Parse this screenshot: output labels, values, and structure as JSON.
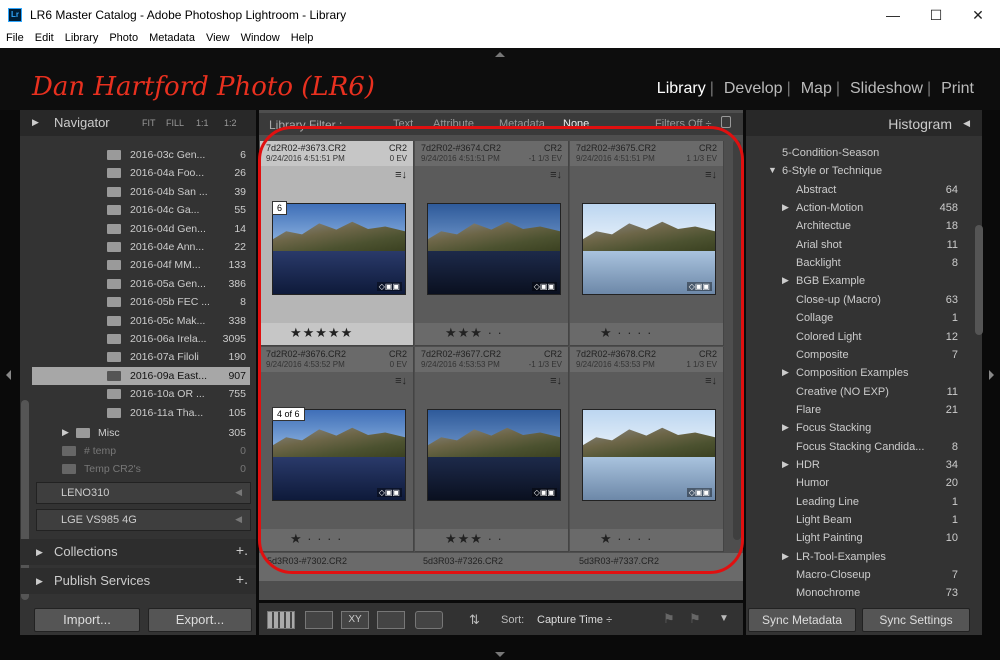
{
  "window": {
    "title": "LR6 Master Catalog - Adobe Photoshop Lightroom - Library",
    "app_icon": "Lr",
    "controls": {
      "minimize": "—",
      "maximize": "☐",
      "close": "✕"
    }
  },
  "menu": [
    "File",
    "Edit",
    "Library",
    "Photo",
    "Metadata",
    "View",
    "Window",
    "Help"
  ],
  "identity_plate": "Dan Hartford Photo (LR6)",
  "modules": [
    {
      "label": "Library",
      "active": true
    },
    {
      "label": "Develop",
      "active": false
    },
    {
      "label": "Map",
      "active": false
    },
    {
      "label": "Slideshow",
      "active": false
    },
    {
      "label": "Print",
      "active": false
    }
  ],
  "navigator": {
    "title": "Navigator",
    "zoom": [
      "FIT",
      "FILL",
      "1:1",
      "1:2"
    ]
  },
  "folders": [
    {
      "name": "2016-03c Gen...",
      "count": "6",
      "selected": false
    },
    {
      "name": "2016-04a Foo...",
      "count": "26",
      "selected": false
    },
    {
      "name": "2016-04b San ...",
      "count": "39",
      "selected": false
    },
    {
      "name": "2016-04c Ga...",
      "count": "55",
      "selected": false
    },
    {
      "name": "2016-04d Gen...",
      "count": "14",
      "selected": false
    },
    {
      "name": "2016-04e Ann...",
      "count": "22",
      "selected": false
    },
    {
      "name": "2016-04f MM...",
      "count": "133",
      "selected": false
    },
    {
      "name": "2016-05a Gen...",
      "count": "386",
      "selected": false
    },
    {
      "name": "2016-05b FEC ...",
      "count": "8",
      "selected": false
    },
    {
      "name": "2016-05c Mak...",
      "count": "338",
      "selected": false
    },
    {
      "name": "2016-06a Irela...",
      "count": "3095",
      "selected": false
    },
    {
      "name": "2016-07a Filoli",
      "count": "190",
      "selected": false
    },
    {
      "name": "2016-09a East...",
      "count": "907",
      "selected": true
    },
    {
      "name": "2016-10a OR ...",
      "count": "755",
      "selected": false
    },
    {
      "name": "2016-11a Tha...",
      "count": "105",
      "selected": false
    }
  ],
  "misc_folders": [
    {
      "name": "Misc",
      "count": "305"
    },
    {
      "name": "# temp",
      "count": "0"
    },
    {
      "name": "Temp CR2's",
      "count": "0"
    }
  ],
  "devices": [
    "LENO310",
    "LGE VS985 4G"
  ],
  "collections_label": "Collections",
  "publish_label": "Publish Services",
  "import_label": "Import...",
  "export_label": "Export...",
  "filter_bar": {
    "label": "Library Filter :",
    "options": [
      "Text",
      "Attribute",
      "Metadata",
      "None"
    ],
    "filters_off": "Filters Off ÷"
  },
  "grid": [
    {
      "file": "7d2R02-#3673.CR2",
      "ext": "CR2",
      "date": "9/24/2016 4:51:51 PM",
      "ev": "0 EV",
      "badge": "6",
      "stars": "★★★★★",
      "selected": true
    },
    {
      "file": "7d2R02-#3674.CR2",
      "ext": "CR2",
      "date": "9/24/2016 4:51:51 PM",
      "ev": "-1 1/3 EV",
      "badge": "",
      "stars": "★★★ · ·",
      "selected": false
    },
    {
      "file": "7d2R02-#3675.CR2",
      "ext": "CR2",
      "date": "9/24/2016 4:51:51 PM",
      "ev": "1 1/3 EV",
      "badge": "",
      "stars": "★ · · · ·",
      "selected": false
    },
    {
      "file": "7d2R02-#3676.CR2",
      "ext": "CR2",
      "date": "9/24/2016 4:53:52 PM",
      "ev": "0 EV",
      "badge": "4 of 6",
      "stars": "★ · · · ·",
      "selected": false
    },
    {
      "file": "7d2R02-#3677.CR2",
      "ext": "CR2",
      "date": "9/24/2016 4:53:53 PM",
      "ev": "-1 1/3 EV",
      "badge": "",
      "stars": "★★★ · ·",
      "selected": false
    },
    {
      "file": "7d2R02-#3678.CR2",
      "ext": "CR2",
      "date": "9/24/2016 4:53:53 PM",
      "ev": "1 1/3 EV",
      "badge": "",
      "stars": "★ · · · ·",
      "selected": false
    }
  ],
  "next_row": [
    "5d3R03-#7302.CR2",
    "5d3R03-#7326.CR2",
    "5d3R03-#7337.CR2"
  ],
  "toolbar": {
    "sort_label": "Sort:",
    "sort_value": "Capture Time ÷"
  },
  "histogram_label": "Histogram",
  "keywords": [
    {
      "name": "5-Condition-Season",
      "count": "",
      "arrow": ""
    },
    {
      "name": "6-Style or Technique",
      "count": "",
      "arrow": "▼"
    },
    {
      "name": "Abstract",
      "count": "64",
      "arrow": ""
    },
    {
      "name": "Action-Motion",
      "count": "458",
      "arrow": "▶"
    },
    {
      "name": "Architectue",
      "count": "18",
      "arrow": ""
    },
    {
      "name": "Arial shot",
      "count": "11",
      "arrow": ""
    },
    {
      "name": "Backlight",
      "count": "8",
      "arrow": ""
    },
    {
      "name": "BGB Example",
      "count": "",
      "arrow": "▶"
    },
    {
      "name": "Close-up (Macro)",
      "count": "63",
      "arrow": ""
    },
    {
      "name": "Collage",
      "count": "1",
      "arrow": ""
    },
    {
      "name": "Colored Light",
      "count": "12",
      "arrow": ""
    },
    {
      "name": "Composite",
      "count": "7",
      "arrow": ""
    },
    {
      "name": "Composition Examples",
      "count": "",
      "arrow": "▶"
    },
    {
      "name": "Creative (NO EXP)",
      "count": "11",
      "arrow": ""
    },
    {
      "name": "Flare",
      "count": "21",
      "arrow": ""
    },
    {
      "name": "Focus Stacking",
      "count": "",
      "arrow": "▶"
    },
    {
      "name": "Focus Stacking Candida...",
      "count": "8",
      "arrow": ""
    },
    {
      "name": "HDR",
      "count": "34",
      "arrow": "▶"
    },
    {
      "name": "Humor",
      "count": "20",
      "arrow": ""
    },
    {
      "name": "Leading Line",
      "count": "1",
      "arrow": ""
    },
    {
      "name": "Light Beam",
      "count": "1",
      "arrow": ""
    },
    {
      "name": "Light Painting",
      "count": "10",
      "arrow": ""
    },
    {
      "name": "LR-Tool-Examples",
      "count": "",
      "arrow": "▶"
    },
    {
      "name": "Macro-Closeup",
      "count": "7",
      "arrow": ""
    },
    {
      "name": "Monochrome",
      "count": "73",
      "arrow": ""
    }
  ],
  "sync_metadata": "Sync Metadata",
  "sync_settings": "Sync Settings",
  "colors": {
    "accent_red": "#e01010",
    "brand_red": "#e8301f"
  }
}
